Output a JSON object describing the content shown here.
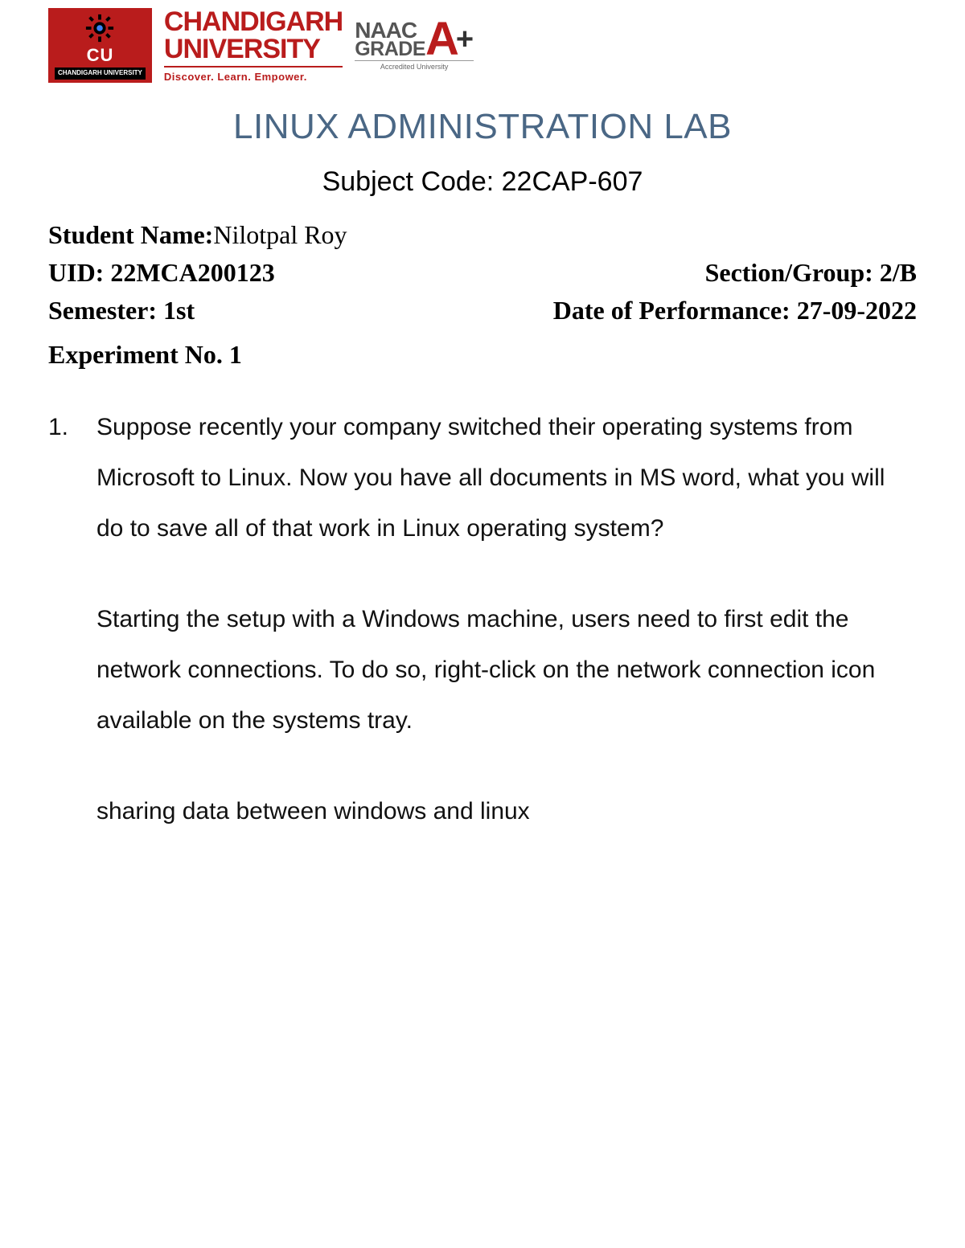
{
  "logo": {
    "cu_badge_text": "CU",
    "cu_badge_sub": "CHANDIGARH UNIVERSITY",
    "university_name_line1": "CHANDIGARH",
    "university_name_line2": "UNIVERSITY",
    "tagline": "Discover. Learn. Empower.",
    "naac_line1": "NAAC",
    "naac_line2": "GRADE",
    "naac_grade": "A",
    "naac_plus": "+",
    "naac_accredited": "Accredited University"
  },
  "title": "LINUX ADMINISTRATION LAB",
  "subject_code": {
    "label": "Subject Code: ",
    "value": "22CAP-607"
  },
  "student": {
    "name_label": "Student Name: ",
    "name_value": "Nilotpal Roy",
    "uid_label": "UID: ",
    "uid_value": "22MCA200123",
    "section_label": "Section/Group: ",
    "section_value": "2/B",
    "semester_label": "Semester:  ",
    "semester_value": "1st",
    "date_label": "Date of Performance: ",
    "date_value": "27-09-2022"
  },
  "experiment_label": "Experiment No. 1",
  "question": {
    "number": "1.",
    "text": "Suppose recently your company switched their operating systems from Microsoft to Linux. Now you have all documents in MS word, what you will do to save all of that work in Linux operating system?",
    "answer": " Starting the setup with a Windows machine, users need to first edit the network connections. To do so, right-click on the network connection icon available on the systems tray.",
    "subheading": "sharing data between windows and linux"
  }
}
